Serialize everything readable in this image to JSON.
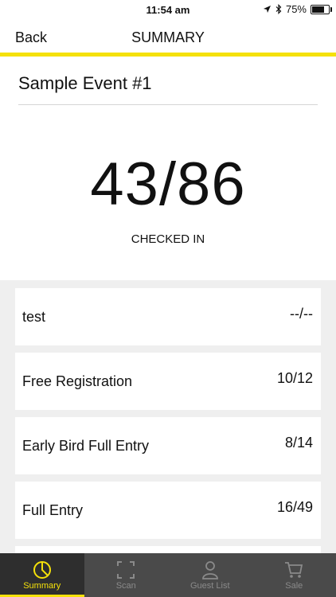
{
  "status_bar": {
    "time": "11:54 am",
    "battery": "75%",
    "battery_level": 0.75
  },
  "nav": {
    "back_label": "Back",
    "title": "SUMMARY"
  },
  "event": {
    "name": "Sample Event #1",
    "checked_in": "43/86",
    "checked_in_label": "CHECKED IN"
  },
  "ticket_types": [
    {
      "name": "test",
      "count": "--/--"
    },
    {
      "name": "Free Registration",
      "count": "10/12"
    },
    {
      "name": "Early Bird Full Entry",
      "count": "8/14"
    },
    {
      "name": "Full Entry",
      "count": "16/49"
    }
  ],
  "tabs": [
    {
      "label": "Summary",
      "icon": "pie-chart-icon",
      "active": true
    },
    {
      "label": "Scan",
      "icon": "scan-frame-icon",
      "active": false
    },
    {
      "label": "Guest List",
      "icon": "person-icon",
      "active": false
    },
    {
      "label": "Sale",
      "icon": "cart-icon",
      "active": false
    }
  ],
  "colors": {
    "accent": "#f5e10a",
    "tab_bar": "#4a4a4a",
    "tab_active_bg": "#2e2e2e",
    "list_bg": "#efefef"
  }
}
